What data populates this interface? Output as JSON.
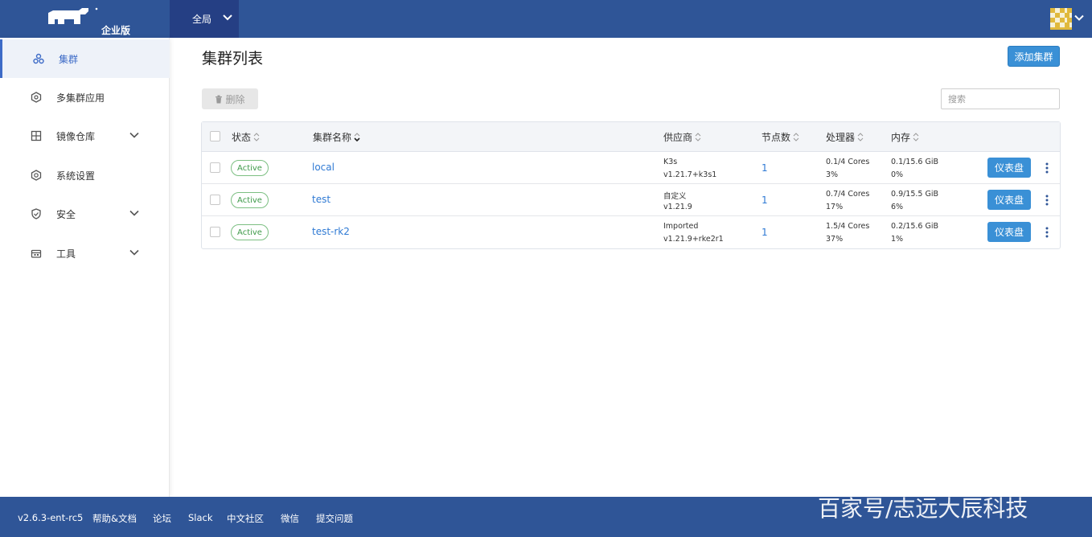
{
  "header": {
    "edition": "企业版",
    "scope": "全局"
  },
  "sidebar": {
    "items": [
      {
        "label": "集群",
        "icon": "cluster-icon",
        "active": true
      },
      {
        "label": "多集群应用",
        "icon": "apps-icon"
      },
      {
        "label": "镜像仓库",
        "icon": "registry-icon",
        "expandable": true
      },
      {
        "label": "系统设置",
        "icon": "settings-icon"
      },
      {
        "label": "安全",
        "icon": "shield-icon",
        "expandable": true
      },
      {
        "label": "工具",
        "icon": "tools-icon",
        "expandable": true
      }
    ]
  },
  "main": {
    "title": "集群列表",
    "add_label": "添加集群",
    "delete_label": "删除",
    "search_placeholder": "搜索"
  },
  "table": {
    "columns": [
      "状态",
      "集群名称",
      "供应商",
      "节点数",
      "处理器",
      "内存"
    ],
    "rows": [
      {
        "state": "Active",
        "name": "local",
        "provider": "K3s",
        "version": "v1.21.7+k3s1",
        "nodes": "1",
        "cpu": "0.1/4 Cores",
        "cpu_pct": "3%",
        "mem": "0.1/15.6 GiB",
        "mem_pct": "0%",
        "action": "仪表盘"
      },
      {
        "state": "Active",
        "name": "test",
        "provider": "自定义",
        "version": "v1.21.9",
        "nodes": "1",
        "cpu": "0.7/4 Cores",
        "cpu_pct": "17%",
        "mem": "0.9/15.5 GiB",
        "mem_pct": "6%",
        "action": "仪表盘"
      },
      {
        "state": "Active",
        "name": "test-rk2",
        "provider": "Imported",
        "version": "v1.21.9+rke2r1",
        "nodes": "1",
        "cpu": "1.5/4 Cores",
        "cpu_pct": "37%",
        "mem": "0.2/15.6 GiB",
        "mem_pct": "1%",
        "action": "仪表盘"
      }
    ]
  },
  "footer": {
    "version": "v2.6.3-ent-rc5",
    "links": [
      "帮助&文档",
      "论坛",
      "Slack",
      "中文社区",
      "微信",
      "提交问题"
    ],
    "watermark": "百家号/志远大辰科技"
  },
  "colors": {
    "header": "#2f5597",
    "primary": "#3a90d6",
    "active_badge": "#3f9a4a"
  }
}
